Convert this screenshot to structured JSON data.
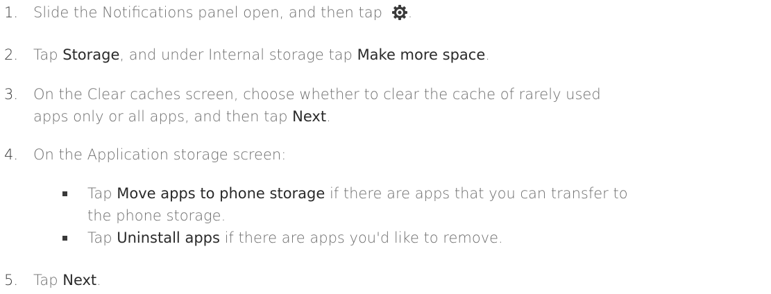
{
  "steps": [
    {
      "num": "1.",
      "t1": "Slide the Notifications panel open, and then tap ",
      "icon": "gear-icon",
      "t2": "."
    },
    {
      "num": "2.",
      "t1": "Tap ",
      "b1": "Storage",
      "t2": ", and under Internal storage tap ",
      "b2": "Make more space",
      "t3": "."
    },
    {
      "num": "3.",
      "line1": "On the Clear caches screen, choose whether to clear the cache of rarely used",
      "line2_pre": "apps only or all apps, and then tap ",
      "b1": "Next",
      "line2_post": "."
    },
    {
      "num": "4.",
      "t1": "On the Application storage screen:"
    },
    {
      "num": "5.",
      "t1": "Tap ",
      "b1": "Next",
      "t2": "."
    }
  ],
  "bullets": [
    {
      "pre": "Tap ",
      "b": "Move apps to phone storage",
      "post": " if there are apps that you can transfer to",
      "line2": "the phone storage."
    },
    {
      "pre": "Tap ",
      "b": "Uninstall apps",
      "post": " if there are apps you'd like to remove."
    }
  ]
}
